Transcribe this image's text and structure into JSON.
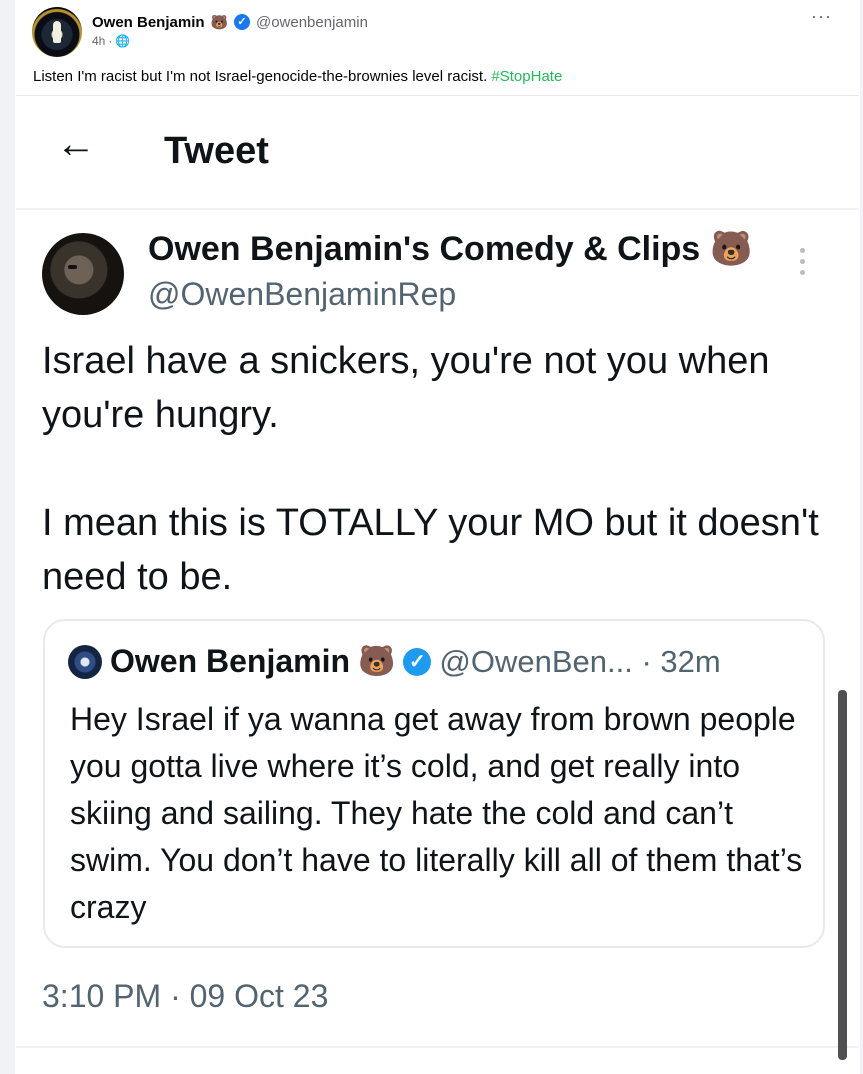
{
  "post": {
    "author_name": "Owen Benjamin",
    "author_emoji": "🐻",
    "author_handle": "@owenbenjamin",
    "time": "4h",
    "meta_sep": "·",
    "audience_icon": "globe-icon",
    "more": "···",
    "text": "Listen I'm racist but I'm not Israel-genocide-the-brownies level racist.",
    "hashtag": "#StopHate",
    "hashtag_color": "#1fba58"
  },
  "tweet": {
    "back_icon": "←",
    "header_title": "Tweet",
    "author_name": "Owen Benjamin's Comedy & Clips",
    "author_emoji": "🐻",
    "author_handle": "@OwenBenjaminRep",
    "body_line1": "Israel have a snickers, you're not you when you're hungry.",
    "body_line2": "I mean this is TOTALLY your MO but it doesn't need to be.",
    "timestamp": "3:10 PM · 09 Oct 23"
  },
  "quoted": {
    "author_name": "Owen Benjamin",
    "author_emoji": "🐻",
    "verified": "✓",
    "handle_time": "@OwenBen... · 32m",
    "text": "Hey Israel if ya wanna get away from brown people you gotta live where it’s cold, and get really into skiing and sailing. They hate the cold and can’t swim. You don’t have to literally kill all of them that’s crazy"
  },
  "colors": {
    "verified_blue": "#1d9bf0",
    "facebook_verified": "#1877f2",
    "text_secondary": "#536471"
  }
}
